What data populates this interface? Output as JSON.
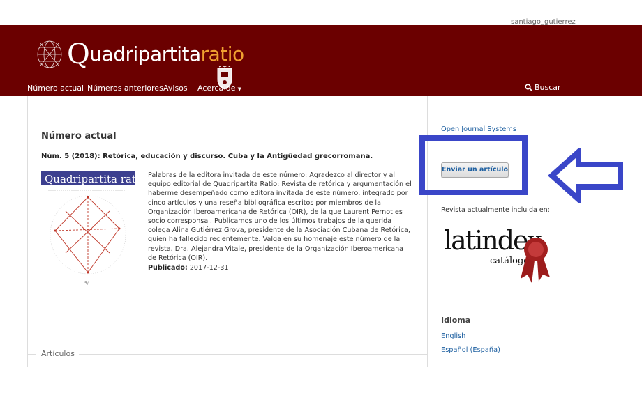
{
  "topbar": {
    "user": "santiago_gutierrez"
  },
  "brand": {
    "logo_q": "Q",
    "logo_main": "uadripartita",
    "logo_ratio": "ratio",
    "accent": "#f0a030",
    "header_bg": "#6b0000"
  },
  "nav": {
    "items": [
      "Número actual",
      "Números anteriores",
      "Avisos",
      "Acerca de"
    ],
    "search": "Buscar"
  },
  "main": {
    "page_title": "Número actual",
    "issue_title": "Núm. 5 (2018): Retórica, educación y discurso. Cuba y la Antigüedad grecorromana.",
    "description": "Palabras de la editora invitada de este número:   Agradezco al director y al equipo editorial de Quadripartita Ratio: Revista de retórica y argumentación el haberme desempeñado como editora invitada de este número, integrado por cinco artículos y una reseña bibliográfica escritos por miembros de la Organización Iberoamericana de Retórica (OIR), de la que Laurent Pernot es socio corresponsal. Publicamos uno de los últimos trabajos de la querida colega Alina Gutiérrez Grova, presidente de la Asociación Cubana de Retórica, quien ha fallecido recientemente. Valga en su homenaje este número de la revista.   Dra. Alejandra Vitale, presidente de la Organización Iberoamericana de Retórica (OIR).",
    "published_label": "Publicado:",
    "published_date": "2017-12-31",
    "section": "Artículos",
    "cover_caption": "Quadripartita ratio"
  },
  "sidebar": {
    "ojs_link": "Open Journal Systems",
    "submit_button": "Enviar un artículo",
    "indexed_text": "Revista actualmente incluida en:",
    "latindex_main": "latindex",
    "latindex_sub": "catálogo",
    "language_title": "Idioma",
    "languages": [
      "English",
      "Español (España)"
    ],
    "highlight_color": "#3a46c8"
  }
}
